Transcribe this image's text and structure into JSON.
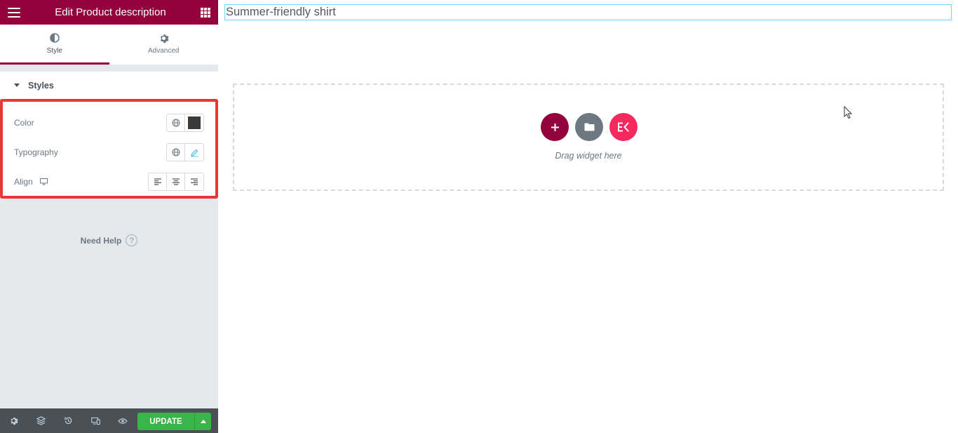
{
  "header": {
    "title": "Edit Product description"
  },
  "tabs": [
    {
      "label": "Style",
      "active": true
    },
    {
      "label": "Advanced",
      "active": false
    }
  ],
  "section": {
    "title": "Styles"
  },
  "controls": {
    "color_label": "Color",
    "typography_label": "Typography",
    "align_label": "Align",
    "color_value": "#3a3a3a"
  },
  "help": {
    "label": "Need Help",
    "icon": "question-icon"
  },
  "footer": {
    "update_label": "UPDATE"
  },
  "canvas": {
    "product_title": "Summer-friendly shirt",
    "drop_label": "Drag widget here"
  },
  "colors": {
    "brand": "#93003c",
    "update": "#39b54a",
    "highlight": "#e53935",
    "ek_accent": "#f5295e"
  }
}
